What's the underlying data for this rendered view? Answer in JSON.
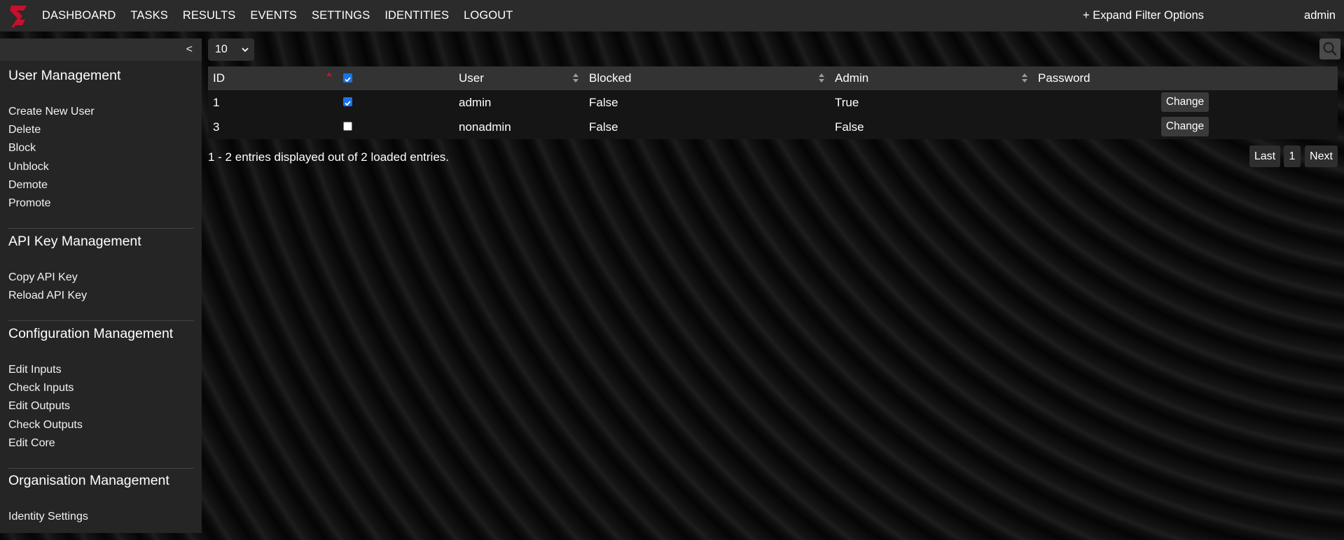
{
  "nav": {
    "items": [
      {
        "label": "DASHBOARD",
        "name": "nav-dashboard"
      },
      {
        "label": "TASKS",
        "name": "nav-tasks"
      },
      {
        "label": "RESULTS",
        "name": "nav-results"
      },
      {
        "label": "EVENTS",
        "name": "nav-events"
      },
      {
        "label": "SETTINGS",
        "name": "nav-settings"
      },
      {
        "label": "IDENTITIES",
        "name": "nav-identities"
      },
      {
        "label": "LOGOUT",
        "name": "nav-logout"
      }
    ],
    "expand_filter": "+ Expand Filter Options",
    "user": "admin",
    "logo_icon": "logo-icon"
  },
  "sidebar": {
    "collapse_label": "<",
    "sections": {
      "user": {
        "title": "User Management",
        "links": [
          "Create New User",
          "Delete",
          "Block",
          "Unblock",
          "Demote",
          "Promote"
        ]
      },
      "api": {
        "title": "API Key Management",
        "links": [
          "Copy API Key",
          "Reload API Key"
        ]
      },
      "config": {
        "title": "Configuration Management",
        "links": [
          "Edit Inputs",
          "Check Inputs",
          "Edit Outputs",
          "Check Outputs",
          "Edit Core"
        ]
      },
      "org": {
        "title": "Organisation Management",
        "links": [
          "Identity Settings"
        ]
      }
    }
  },
  "table": {
    "page_size": "10",
    "headers": {
      "id": "ID",
      "user": "User",
      "blocked": "Blocked",
      "admin": "Admin",
      "password": "Password"
    },
    "select_all_checked": true,
    "rows": [
      {
        "id": "1",
        "checked": true,
        "user": "admin",
        "blocked": "False",
        "admin": "True",
        "action": "Change"
      },
      {
        "id": "3",
        "checked": false,
        "user": "nonadmin",
        "blocked": "False",
        "admin": "False",
        "action": "Change"
      }
    ]
  },
  "footer": {
    "entries_info": "1 - 2 entries displayed out of 2 loaded entries.",
    "pager": {
      "last": "Last",
      "page": "1",
      "next": "Next"
    }
  },
  "colors": {
    "accent": "#c8102e",
    "checkbox": "#1a73e8",
    "topbar": "#2b2b2b",
    "sidebar": "#252525"
  }
}
